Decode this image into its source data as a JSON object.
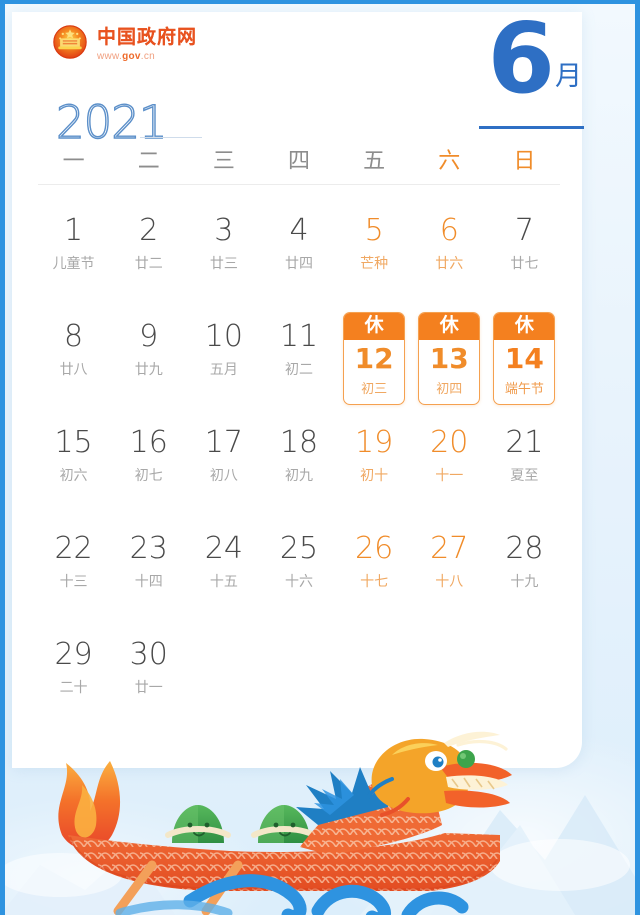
{
  "brand": {
    "name_cn": "中国政府网",
    "url_prefix": "www.",
    "url_bold": "gov",
    "url_suffix": ".cn",
    "emblem_icon": "national-emblem-icon"
  },
  "header": {
    "year": "2021",
    "month_number": "6",
    "month_suffix": "月",
    "accent_blue": "#2e6fc4",
    "accent_orange": "#f4801f"
  },
  "weekdays": [
    {
      "label": "一",
      "weekend": false
    },
    {
      "label": "二",
      "weekend": false
    },
    {
      "label": "三",
      "weekend": false
    },
    {
      "label": "四",
      "weekend": false
    },
    {
      "label": "五",
      "weekend": false
    },
    {
      "label": "六",
      "weekend": true
    },
    {
      "label": "日",
      "weekend": true
    }
  ],
  "holiday_badge_label": "休",
  "days": [
    {
      "num": "1",
      "lunar": "儿童节",
      "weekend": false,
      "holiday": false
    },
    {
      "num": "2",
      "lunar": "廿二",
      "weekend": false,
      "holiday": false
    },
    {
      "num": "3",
      "lunar": "廿三",
      "weekend": false,
      "holiday": false
    },
    {
      "num": "4",
      "lunar": "廿四",
      "weekend": false,
      "holiday": false
    },
    {
      "num": "5",
      "lunar": "芒种",
      "weekend": true,
      "holiday": false
    },
    {
      "num": "6",
      "lunar": "廿六",
      "weekend": true,
      "holiday": false
    },
    {
      "num": "7",
      "lunar": "廿七",
      "weekend": false,
      "holiday": false
    },
    {
      "num": "8",
      "lunar": "廿八",
      "weekend": false,
      "holiday": false
    },
    {
      "num": "9",
      "lunar": "廿九",
      "weekend": false,
      "holiday": false
    },
    {
      "num": "10",
      "lunar": "五月",
      "weekend": false,
      "holiday": false
    },
    {
      "num": "11",
      "lunar": "初二",
      "weekend": false,
      "holiday": false
    },
    {
      "num": "12",
      "lunar": "初三",
      "weekend": true,
      "holiday": true
    },
    {
      "num": "13",
      "lunar": "初四",
      "weekend": true,
      "holiday": true
    },
    {
      "num": "14",
      "lunar": "端午节",
      "weekend": false,
      "holiday": true
    },
    {
      "num": "15",
      "lunar": "初六",
      "weekend": false,
      "holiday": false
    },
    {
      "num": "16",
      "lunar": "初七",
      "weekend": false,
      "holiday": false
    },
    {
      "num": "17",
      "lunar": "初八",
      "weekend": false,
      "holiday": false
    },
    {
      "num": "18",
      "lunar": "初九",
      "weekend": false,
      "holiday": false
    },
    {
      "num": "19",
      "lunar": "初十",
      "weekend": true,
      "holiday": false
    },
    {
      "num": "20",
      "lunar": "十一",
      "weekend": true,
      "holiday": false
    },
    {
      "num": "21",
      "lunar": "夏至",
      "weekend": false,
      "holiday": false
    },
    {
      "num": "22",
      "lunar": "十三",
      "weekend": false,
      "holiday": false
    },
    {
      "num": "23",
      "lunar": "十四",
      "weekend": false,
      "holiday": false
    },
    {
      "num": "24",
      "lunar": "十五",
      "weekend": false,
      "holiday": false
    },
    {
      "num": "25",
      "lunar": "十六",
      "weekend": false,
      "holiday": false
    },
    {
      "num": "26",
      "lunar": "十七",
      "weekend": true,
      "holiday": false
    },
    {
      "num": "27",
      "lunar": "十八",
      "weekend": true,
      "holiday": false
    },
    {
      "num": "28",
      "lunar": "十九",
      "weekend": false,
      "holiday": false
    },
    {
      "num": "29",
      "lunar": "二十",
      "weekend": false,
      "holiday": false
    },
    {
      "num": "30",
      "lunar": "廿一",
      "weekend": false,
      "holiday": false
    }
  ],
  "illustration": {
    "name": "dragon-boat-illustration",
    "boat_color": "#e8512a",
    "dragon_gold": "#f0922a",
    "dragon_blue": "#1f7fc4",
    "zongzi_green": "#3da44b",
    "wave_blue": "#2e93e0",
    "flame_orange": "#f4642a"
  }
}
